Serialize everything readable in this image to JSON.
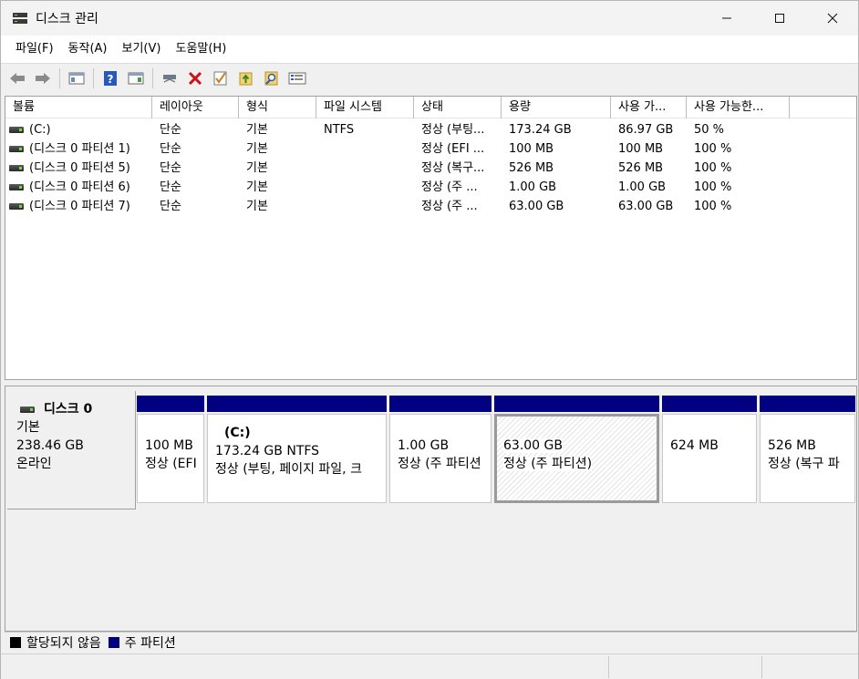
{
  "window": {
    "title": "디스크 관리",
    "controls": {
      "minimize": "—",
      "maximize": "☐",
      "close": "✕"
    }
  },
  "menu": [
    "파일(F)",
    "동작(A)",
    "보기(V)",
    "도움말(H)"
  ],
  "toolbar": {
    "icons": [
      "back-arrow-icon",
      "forward-arrow-icon",
      "show-hide-console-tree-icon",
      "help-icon",
      "properties-pane-icon",
      "connect-drive-icon",
      "delete-icon",
      "check-icon",
      "import-icon",
      "search-icon",
      "list-icon"
    ]
  },
  "volume_list": {
    "columns": [
      "볼륨",
      "레이아웃",
      "형식",
      "파일 시스템",
      "상태",
      "용량",
      "사용 가...",
      "사용 가능한..."
    ],
    "rows": [
      [
        "(C:)",
        "단순",
        "기본",
        "NTFS",
        "정상 (부팅...",
        "173.24 GB",
        "86.97 GB",
        "50 %"
      ],
      [
        "(디스크 0 파티션 1)",
        "단순",
        "기본",
        "",
        "정상 (EFI ...",
        "100 MB",
        "100 MB",
        "100 %"
      ],
      [
        "(디스크 0 파티션 5)",
        "단순",
        "기본",
        "",
        "정상 (복구...",
        "526 MB",
        "526 MB",
        "100 %"
      ],
      [
        "(디스크 0 파티션 6)",
        "단순",
        "기본",
        "",
        "정상 (주 ...",
        "1.00 GB",
        "1.00 GB",
        "100 %"
      ],
      [
        "(디스크 0 파티션 7)",
        "단순",
        "기본",
        "",
        "정상 (주 ...",
        "63.00 GB",
        "63.00 GB",
        "100 %"
      ]
    ]
  },
  "disk": {
    "name": "디스크 0",
    "type": "기본",
    "size": "238.46 GB",
    "status": "온라인",
    "partitions": [
      {
        "name": "",
        "size": "100 MB",
        "status": "정상 (EFI"
      },
      {
        "name": "(C:)",
        "size": "173.24 GB NTFS",
        "status": "정상 (부팅, 페이지 파일, 크"
      },
      {
        "name": "",
        "size": "1.00 GB",
        "status": "정상 (주 파티션"
      },
      {
        "name": "",
        "size": "63.00 GB",
        "status": "정상 (주 파티션)"
      },
      {
        "name": "",
        "size": "624 MB",
        "status": ""
      },
      {
        "name": "",
        "size": "526 MB",
        "status": "정상 (복구 파"
      }
    ]
  },
  "legend": {
    "unallocated": "할당되지 않음",
    "primary": "주 파티션"
  },
  "colors": {
    "primary_partition": "#000080",
    "unallocated": "#000000",
    "delete_icon": "#d01010"
  }
}
